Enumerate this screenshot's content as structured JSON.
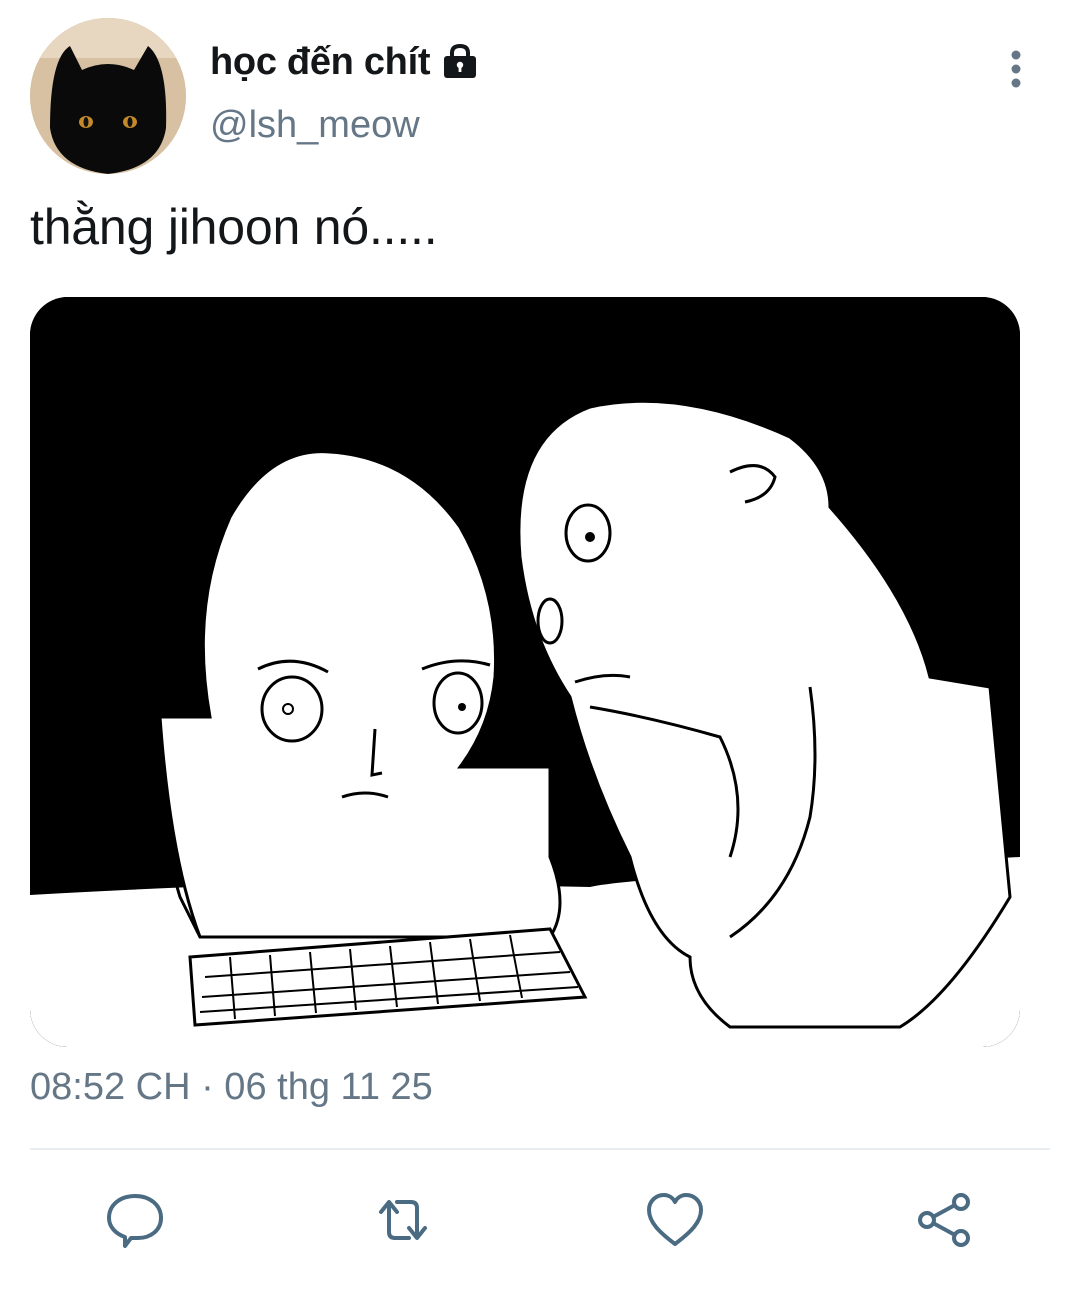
{
  "author": {
    "display_name": "học đến chít",
    "handle": "@lsh_meow",
    "protected_icon": "lock-icon",
    "avatar_icon": "black-cat-avatar"
  },
  "tweet": {
    "text": "thằng jihoon nó.....",
    "timestamp": "08:52 CH · 06 thg 11 25",
    "media_description_icon": "sketch-image"
  },
  "menu": {
    "more_icon": "more-vertical-icon"
  },
  "actions": [
    {
      "name": "reply",
      "icon": "comment-icon"
    },
    {
      "name": "retweet",
      "icon": "retweet-icon"
    },
    {
      "name": "like",
      "icon": "heart-icon"
    },
    {
      "name": "share",
      "icon": "share-icon"
    }
  ],
  "colors": {
    "text_primary": "#14171a",
    "text_secondary": "#657786",
    "icon": "#4a6b82",
    "divider": "#e6ecf0"
  }
}
